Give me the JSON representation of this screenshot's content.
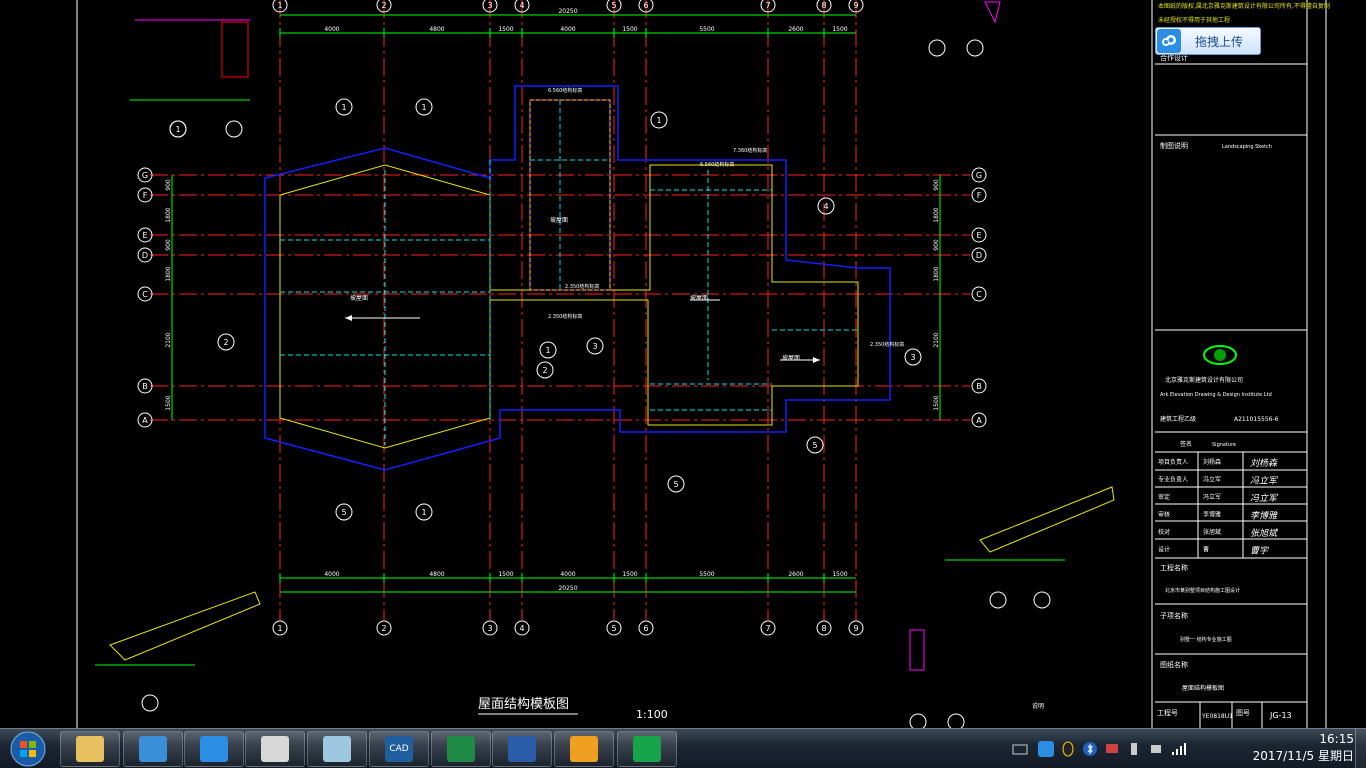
{
  "drawing": {
    "title": "屋面结构模板图",
    "scale": "1:100",
    "dims_top": [
      "4000",
      "4800",
      "1500",
      "4000",
      "1500",
      "5500",
      "2600",
      "1500"
    ],
    "dims_top_total": "20250",
    "dims_bottom": [
      "4000",
      "4800",
      "1500",
      "4000",
      "1500",
      "5500",
      "2600",
      "1500"
    ],
    "dims_bottom_total": "20250",
    "axes_vertical": [
      "1",
      "2",
      "3",
      "4",
      "5",
      "6",
      "7",
      "8",
      "9"
    ],
    "axes_horizontal": [
      "G",
      "F",
      "E",
      "D",
      "C",
      "B",
      "A"
    ],
    "dims_left": [
      "900",
      "1800",
      "900",
      "1800",
      "2100",
      "1500"
    ],
    "section_marks": [
      "1",
      "1",
      "1",
      "1",
      "2",
      "2",
      "3",
      "3",
      "4",
      "5",
      "5",
      "5",
      "1",
      "1"
    ],
    "slab_labels": [
      "坡屋面",
      "坡屋面",
      "坡屋面",
      "坡屋面"
    ],
    "elevations": [
      "6.560结构标高",
      "7.360结构标高",
      "6.560结构标高",
      "2.350结构标高",
      "2.350结构标高",
      "2.350结构标高"
    ],
    "note_title": "说明"
  },
  "title_block": {
    "header_note": "本图纸的版权,属北京雅克斯建筑设计有限公司所有,不得擅自复制",
    "drawing_note": "未经授权不得用于其他工程",
    "sections": [
      "合作设计",
      "制图说明",
      "Landscaping Sketch"
    ],
    "company": "北京雅克斯建筑设计有限公司",
    "company_en": "Ark Elevation Drawing & Design Institute Ltd",
    "cert_label": "建筑工程乙级",
    "cert_no": "A211015556-6",
    "sign_header": "签名",
    "sign_header_en": "Signature",
    "rows": [
      {
        "role": "项目负责人",
        "name": "刘杨森",
        "sig": "刘杨森"
      },
      {
        "role": "专业负责人",
        "name": "冯立军",
        "sig": "冯立军"
      },
      {
        "role": "审定",
        "name": "冯立军",
        "sig": "冯立军"
      },
      {
        "role": "审核",
        "name": "李博雅",
        "sig": "李博雅"
      },
      {
        "role": "校对",
        "name": "张旭斌",
        "sig": "张旭斌"
      },
      {
        "role": "设计",
        "name": "曹",
        "sig": "曹宇"
      }
    ],
    "project_label": "工程名称",
    "project_name": "北京市某别墅项目结构施工图设计",
    "subitem_label": "子项名称",
    "subitem_name": "别墅一 结构专业施工图",
    "drawing_label": "图纸名称",
    "drawing_name": "屋面结构模板图",
    "job_label": "工程号",
    "job_no": "YE0818U1",
    "sheet_label": "图号",
    "sheet_no": "JG-13"
  },
  "upload_widget": {
    "label": "拖拽上传",
    "icon": "cloud-icon"
  },
  "taskbar": {
    "apps": [
      "file-explorer-icon",
      "browser-icon",
      "baidu-netdisk-icon",
      "calculator-icon",
      "notes-icon",
      "cad-icon",
      "excel-icon",
      "word-icon",
      "wps-icon",
      "app-green-icon"
    ],
    "cad_label": "CAD",
    "clock_time": "16:15",
    "clock_date": "2017/11/5 星期日"
  },
  "colors": {
    "grid_red": "#ff2020",
    "dim_green": "#00ff00",
    "beam_yellow": "#ffff00",
    "slab_blue": "#1020ff",
    "cyan": "#00e5e5",
    "white": "#ffffff",
    "magenta": "#ff00ff"
  }
}
